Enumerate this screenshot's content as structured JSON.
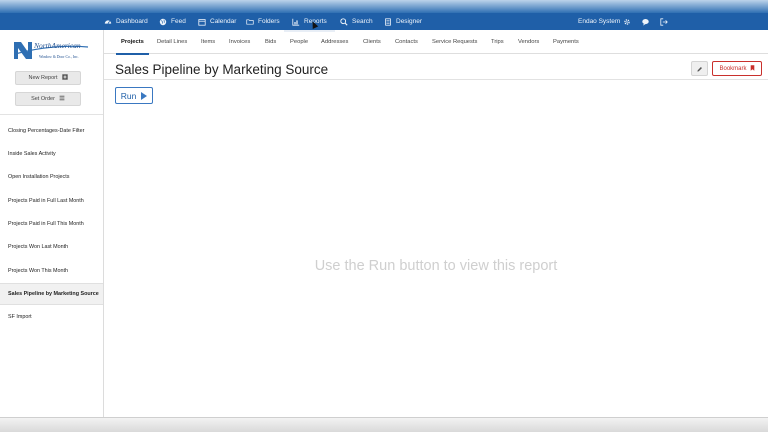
{
  "topnav": {
    "items": [
      {
        "label": "Dashboard",
        "icon": "dashboard-icon"
      },
      {
        "label": "Feed",
        "icon": "globe-icon"
      },
      {
        "label": "Calendar",
        "icon": "calendar-icon"
      },
      {
        "label": "Folders",
        "icon": "folder-icon"
      },
      {
        "label": "Reports",
        "icon": "bar-chart-icon",
        "active": true
      },
      {
        "label": "Search",
        "icon": "search-icon"
      },
      {
        "label": "Designer",
        "icon": "designer-icon"
      }
    ],
    "user": "Endao System"
  },
  "sidebar": {
    "logo_text": "NorthAmerican",
    "logo_subtext": "Window & Door Co., Inc.",
    "new_report_label": "New Report",
    "set_order_label": "Set Order",
    "reports": [
      "Closing Percentages-Date Filter",
      "Inside Sales Activity",
      "Open Installation Projects",
      "Projects Paid in Full Last Month",
      "Projects Paid in Full This Month",
      "Projects Won Last Month",
      "Projects Won This Month",
      "Sales Pipeline by Marketing Source",
      "SF Import"
    ],
    "selected_report": "Sales Pipeline by Marketing Source"
  },
  "subnav": {
    "tabs": [
      "Projects",
      "Detail Lines",
      "Items",
      "Invoices",
      "Bids",
      "People",
      "Addresses",
      "Clients",
      "Contacts",
      "Service Requests",
      "Trips",
      "Vendors",
      "Payments"
    ],
    "active": "Projects"
  },
  "report": {
    "title": "Sales Pipeline by Marketing Source",
    "bookmark_label": "Bookmark",
    "run_label": "Run",
    "empty_message": "Use the Run button to view this report"
  },
  "colors": {
    "nav_bg": "#1f5fa8",
    "accent": "#3a78c1",
    "bookmark": "#c9302c"
  }
}
